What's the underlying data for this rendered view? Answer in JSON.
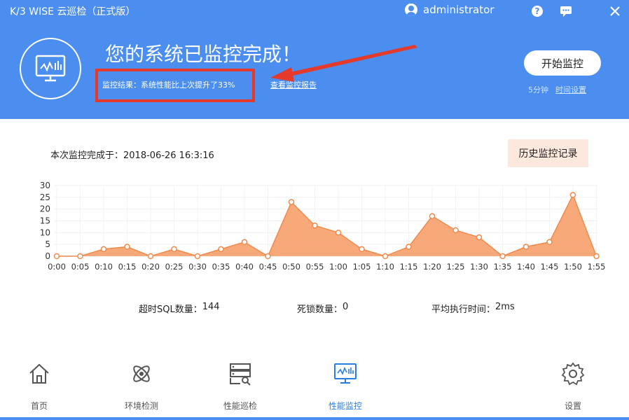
{
  "window": {
    "title": "K/3 WISE 云巡检（正式版）",
    "username": "administrator"
  },
  "hero": {
    "title": "您的系统已监控完成！",
    "result": "监控结果：系统性能比上次提升了33%",
    "report_link": "查看监控报告",
    "start_button": "开始监控",
    "interval": "5分钟",
    "time_setting": "时间设置",
    "colors": {
      "header": "#4b8ef0",
      "highlight_box": "#e33a2c"
    }
  },
  "main": {
    "complete_time": "本次监控完成于：2018-06-26 16:3:16",
    "history_button": "历史监控记录",
    "stats": [
      {
        "label": "超时SQL数量：",
        "value": "144"
      },
      {
        "label": "死锁数量：",
        "value": "0"
      },
      {
        "label": "平均执行时间：",
        "value": "2ms"
      }
    ]
  },
  "chart_data": {
    "type": "area",
    "x": [
      "0:00",
      "0:05",
      "0:10",
      "0:15",
      "0:20",
      "0:25",
      "0:30",
      "0:35",
      "0:40",
      "0:45",
      "0:50",
      "0:55",
      "1:00",
      "1:05",
      "1:10",
      "1:15",
      "1:20",
      "1:25",
      "1:30",
      "1:35",
      "1:40",
      "1:45",
      "1:50",
      "1:55"
    ],
    "values": [
      0,
      0,
      3,
      4,
      0,
      3,
      0,
      3,
      6,
      0,
      23,
      13,
      10,
      3,
      0,
      4,
      17,
      11,
      8,
      0,
      4,
      6,
      26,
      0
    ],
    "ylim": [
      0,
      30
    ],
    "yticks": [
      0,
      5,
      10,
      15,
      20,
      25,
      30
    ],
    "grid": true,
    "color": "#f7a06b"
  },
  "nav": [
    {
      "label": "首页",
      "icon": "home-icon"
    },
    {
      "label": "环境检测",
      "icon": "atom-icon"
    },
    {
      "label": "性能巡检",
      "icon": "server-search-icon"
    },
    {
      "label": "性能监控",
      "icon": "monitor-chart-icon",
      "active": true
    },
    {
      "label": "设置",
      "icon": "gear-icon"
    }
  ]
}
